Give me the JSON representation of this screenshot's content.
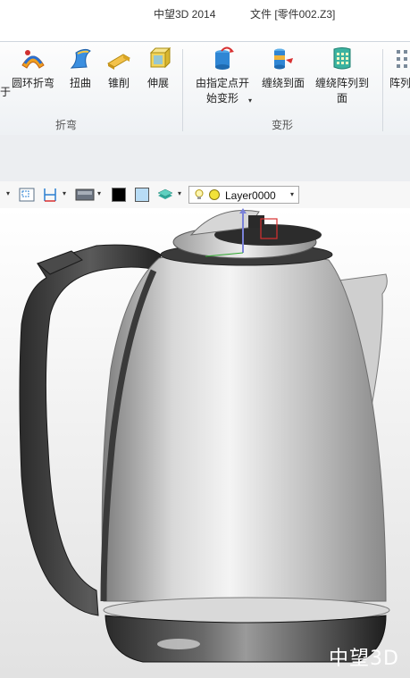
{
  "window": {
    "app_title": "中望3D 2014",
    "doc_title": "文件 [零件002.Z3]"
  },
  "ribbon": {
    "groups": [
      {
        "label": "折弯",
        "buttons": [
          {
            "label": "圆环折弯",
            "icon": "ring-bend-icon"
          },
          {
            "label": "扭曲",
            "icon": "twist-icon"
          },
          {
            "label": "锥削",
            "icon": "taper-icon"
          },
          {
            "label": "伸展",
            "icon": "stretch-icon"
          }
        ]
      },
      {
        "label": "变形",
        "buttons": [
          {
            "label_line1": "由指定点开",
            "label_line2": "始变形",
            "icon": "point-deform-icon",
            "dropdown": "▾"
          },
          {
            "label": "缠绕到面",
            "icon": "wrap-to-face-icon"
          },
          {
            "label_line1": "缠绕阵列到",
            "label_line2": "面",
            "icon": "wrap-pattern-icon"
          }
        ]
      },
      {
        "label": "",
        "buttons": [
          {
            "label": "阵列",
            "icon": "pattern-icon"
          }
        ]
      }
    ],
    "partial_left_char": "于"
  },
  "view_toolbar": {
    "layer_name": "Layer0000",
    "color_swatch_black": "#000000",
    "color_swatch_light": "#b8dcf5",
    "dropdown_arrow": "▾"
  },
  "viewport": {
    "model": "kettle",
    "watermark": "中望3D"
  },
  "colors": {
    "ribbon_bg": "#f3f5f8",
    "accent_blue": "#2a7fd0",
    "kettle_body": "#c9c9c9",
    "kettle_handle": "#3a3a3a"
  }
}
